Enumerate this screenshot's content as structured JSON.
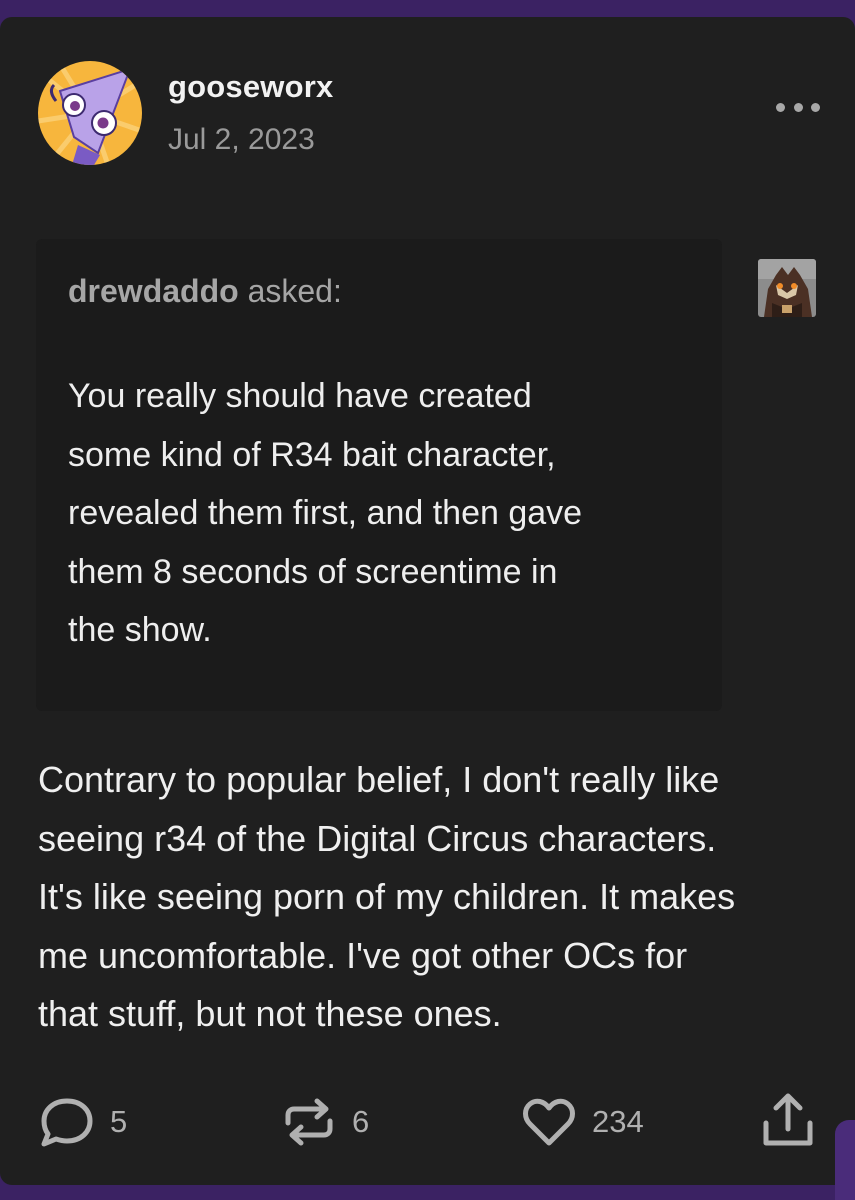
{
  "post": {
    "author": "gooseworx",
    "date": "Jul 2, 2023",
    "more_icon": "more-horizontal-icon"
  },
  "ask": {
    "asker": "drewdaddo",
    "asked_label": " asked:",
    "question": "You really should have created\nsome kind of R34 bait character,\nrevealed them first, and then gave\nthem 8 seconds of screentime in\nthe show."
  },
  "answer": {
    "text": "Contrary to popular belief, I don't really like\nseeing r34 of the Digital Circus characters.\nIt's like seeing porn of my children. It makes\nme uncomfortable. I've got other OCs for\nthat stuff, but not these ones."
  },
  "actions": {
    "comments": "5",
    "reblogs": "6",
    "likes": "234"
  },
  "colors": {
    "background": "#3b2263",
    "card": "#1f1f1f",
    "text": "#ededed",
    "muted": "#9a9a9a",
    "avatar_bg": "#f6b73c"
  }
}
